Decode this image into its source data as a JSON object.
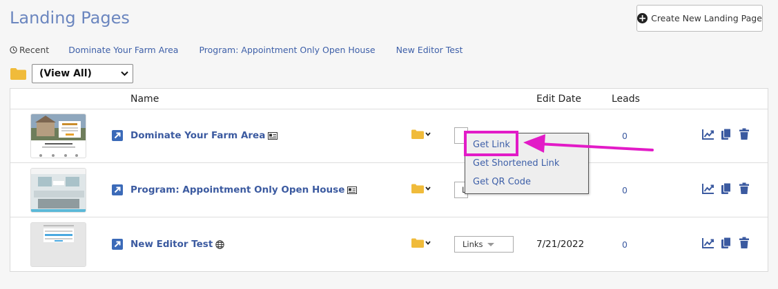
{
  "header": {
    "title": "Landing Pages",
    "create_button_label": "Create New Landing Page"
  },
  "recent": {
    "label": "Recent",
    "links": [
      "Dominate Your Farm Area",
      "Program: Appointment Only Open House",
      "New Editor Test"
    ]
  },
  "folder_filter": {
    "selected": "(View All)"
  },
  "table": {
    "columns": {
      "name": "Name",
      "edit_date": "Edit Date",
      "leads": "Leads"
    },
    "rows": [
      {
        "name": "Dominate Your Farm Area",
        "type_icon": "id-card-icon",
        "links_label": "",
        "edit_date": "",
        "leads": "0"
      },
      {
        "name": "Program: Appointment Only Open House",
        "type_icon": "id-card-icon",
        "links_label": "L",
        "edit_date": "",
        "leads": "0"
      },
      {
        "name": "New Editor Test",
        "type_icon": "globe-icon",
        "links_label": "Links",
        "edit_date": "7/21/2022",
        "leads": "0"
      }
    ]
  },
  "links_menu": {
    "items": [
      "Get Link",
      "Get Shortened Link",
      "Get QR Code"
    ],
    "highlighted": "Get Link"
  },
  "colors": {
    "title": "#6b86bf",
    "link": "#3d5fa8",
    "folder": "#f0bb3a",
    "action_icon": "#3b5aa0",
    "annotation": "#e21bc7"
  }
}
